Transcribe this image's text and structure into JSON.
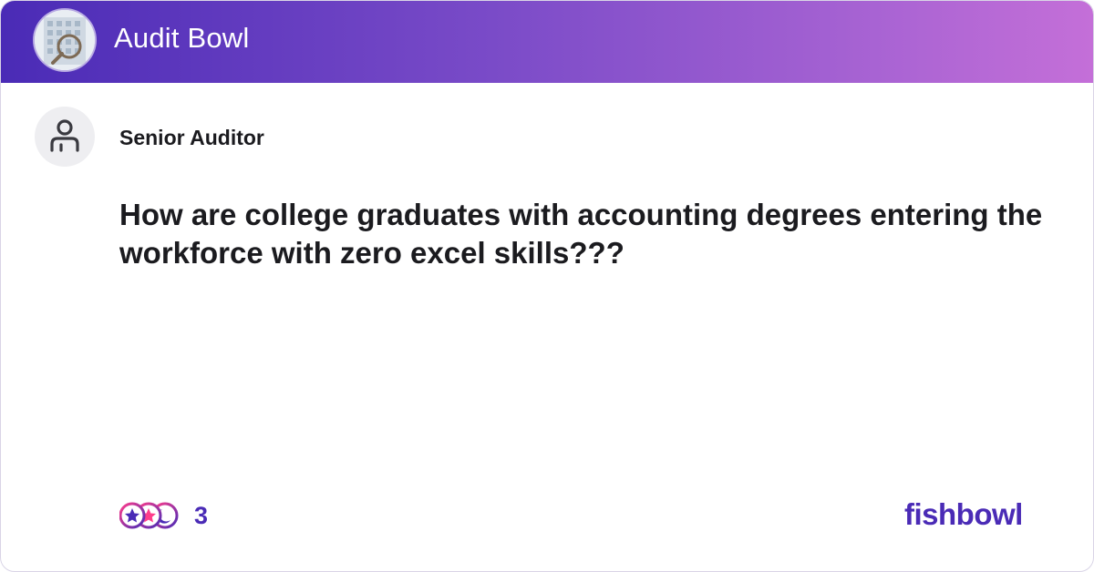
{
  "header": {
    "bowl_name": "Audit Bowl",
    "gradient_start": "#4a2bb6",
    "gradient_end": "#c46fd8",
    "logo_icon": "bowl-avatar-building-icon"
  },
  "post": {
    "author_icon": "user-icon",
    "author": "Senior Auditor",
    "text": "How are college graduates with accounting degrees entering the workforce with zero excel skills???"
  },
  "footer": {
    "reaction_icons": [
      "star-reaction-icon",
      "moon-reaction-icon",
      "star-reaction-icon"
    ],
    "reaction_count": "3",
    "brand": "fishbowl",
    "brand_color": "#4a2bb6"
  }
}
